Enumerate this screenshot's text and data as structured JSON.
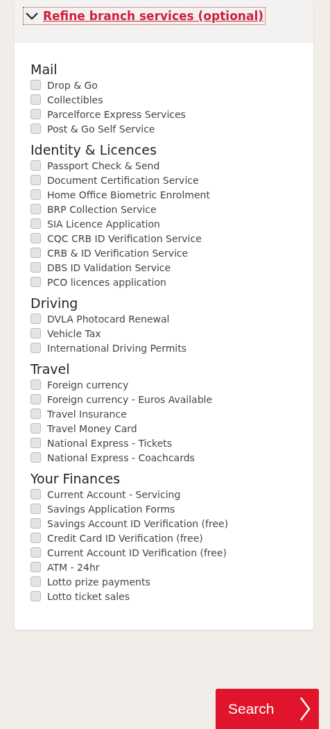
{
  "toggle": {
    "label": "Refine branch services (optional)",
    "expanded": true
  },
  "groups": [
    {
      "title": "Mail",
      "items": [
        {
          "label": "Drop & Go",
          "checked": false
        },
        {
          "label": "Collectibles",
          "checked": false
        },
        {
          "label": "Parcelforce Express Services",
          "checked": false
        },
        {
          "label": "Post & Go Self Service",
          "checked": false
        }
      ]
    },
    {
      "title": "Identity & Licences",
      "items": [
        {
          "label": "Passport Check & Send",
          "checked": false
        },
        {
          "label": "Document Certification Service",
          "checked": false
        },
        {
          "label": "Home Office Biometric Enrolment",
          "checked": false
        },
        {
          "label": "BRP Collection Service",
          "checked": false
        },
        {
          "label": "SIA Licence Application",
          "checked": false
        },
        {
          "label": "CQC CRB ID Verification Service",
          "checked": false
        },
        {
          "label": "CRB & ID Verification Service",
          "checked": false
        },
        {
          "label": "DBS ID Validation Service",
          "checked": false
        },
        {
          "label": "PCO licences application",
          "checked": false
        }
      ]
    },
    {
      "title": "Driving",
      "items": [
        {
          "label": "DVLA Photocard Renewal",
          "checked": false
        },
        {
          "label": "Vehicle Tax",
          "checked": false
        },
        {
          "label": "International Driving Permits",
          "checked": false
        }
      ]
    },
    {
      "title": "Travel",
      "items": [
        {
          "label": "Foreign currency",
          "checked": false
        },
        {
          "label": "Foreign currency - Euros Available",
          "checked": false
        },
        {
          "label": "Travel Insurance",
          "checked": false
        },
        {
          "label": "Travel Money Card",
          "checked": false
        },
        {
          "label": "National Express - Tickets",
          "checked": false
        },
        {
          "label": "National Express - Coachcards",
          "checked": false
        }
      ]
    },
    {
      "title": "Your Finances",
      "items": [
        {
          "label": "Current Account - Servicing",
          "checked": false
        },
        {
          "label": "Savings Application Forms",
          "checked": false
        },
        {
          "label": "Savings Account ID Verification (free)",
          "checked": false
        },
        {
          "label": "Credit Card ID Verification (free)",
          "checked": false
        },
        {
          "label": "Current Account ID Verification (free)",
          "checked": false
        },
        {
          "label": "ATM - 24hr",
          "checked": false
        },
        {
          "label": "Lotto prize payments",
          "checked": false
        },
        {
          "label": "Lotto ticket sales",
          "checked": false
        }
      ]
    }
  ],
  "search_button": {
    "label": "Search"
  }
}
